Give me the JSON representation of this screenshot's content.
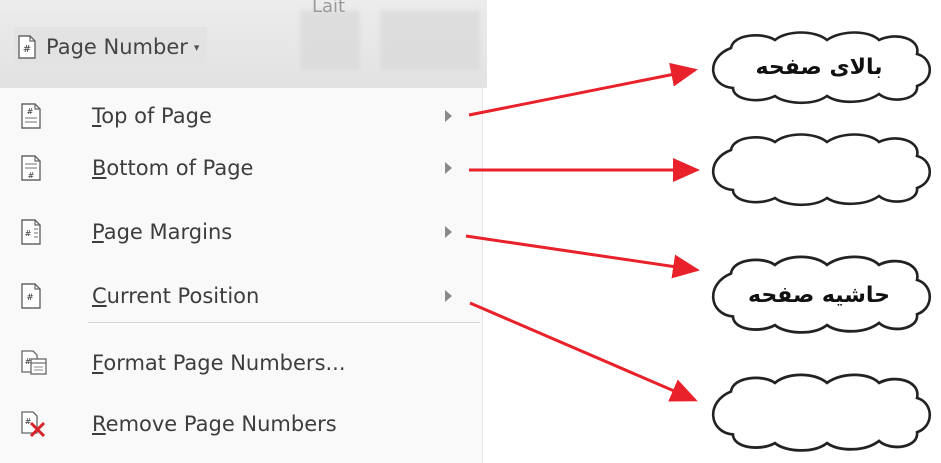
{
  "ribbon": {
    "hint_text": "Lait"
  },
  "page_number_button": {
    "label": "Page Number",
    "caret": "▾"
  },
  "menu": {
    "items": [
      {
        "label": "Top of Page",
        "has_submenu": true,
        "icon": "page-top-number-icon"
      },
      {
        "label": "Bottom of Page",
        "has_submenu": true,
        "icon": "page-bottom-number-icon"
      },
      {
        "label": "Page Margins",
        "has_submenu": true,
        "icon": "page-margin-number-icon"
      },
      {
        "label": "Current Position",
        "has_submenu": true,
        "icon": "current-position-number-icon"
      },
      {
        "label": "Format Page Numbers...",
        "has_submenu": false,
        "icon": "format-page-numbers-icon"
      },
      {
        "label": "Remove Page Numbers",
        "has_submenu": false,
        "icon": "remove-page-numbers-icon"
      }
    ]
  },
  "callouts": [
    {
      "text": "بالای صفحه"
    },
    {
      "text": ""
    },
    {
      "text": "حاشیه صفحه"
    },
    {
      "text": ""
    }
  ],
  "colors": {
    "arrow": "#e8212a",
    "menu_bg": "#f9f9f9",
    "ribbon_bg": "#e3e3e3"
  }
}
